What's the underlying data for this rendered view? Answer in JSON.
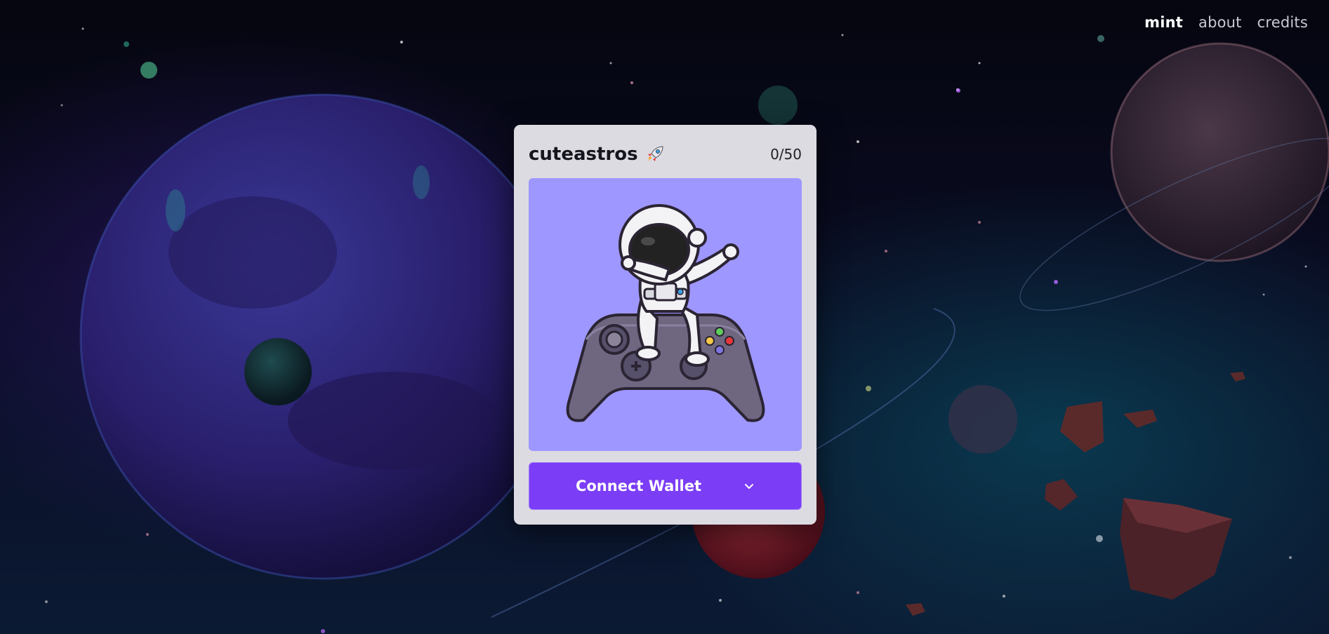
{
  "nav": {
    "items": [
      {
        "label": "mint",
        "active": true
      },
      {
        "label": "about",
        "active": false
      },
      {
        "label": "credits",
        "active": false
      }
    ]
  },
  "card": {
    "title": "cuteastros",
    "title_icon": "rocket-icon",
    "counter": "0/50",
    "artwork": "astronaut-on-gamepad-illustration",
    "connect_label": "Connect Wallet",
    "connect_icon": "chevron-down-icon"
  },
  "colors": {
    "card_bg": "#dcdbe2",
    "art_bg": "#9e97ff",
    "button_bg": "#7b3df5"
  }
}
